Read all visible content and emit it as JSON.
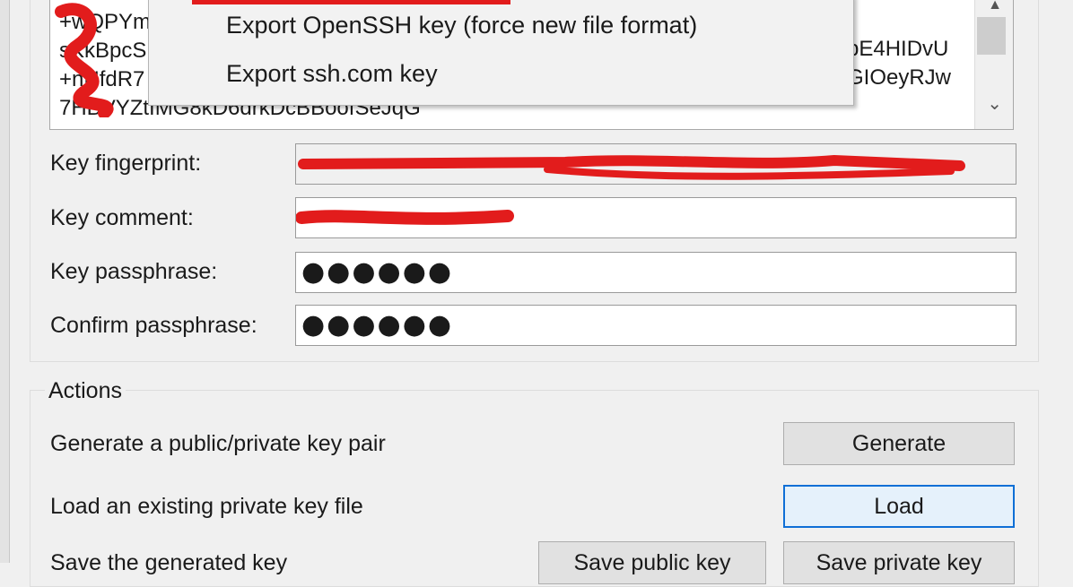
{
  "key_box": {
    "lines": [
      "+wQPYmbX",
      "sKkBpcS",
      "+nNfdR7",
      "7HBVYZtIMG8kD6drkDcBBoofSeJqG"
    ],
    "right_fragments": [
      "pE4HIDvU",
      "GIOeyRJw"
    ]
  },
  "context_menu": {
    "items": [
      "Export OpenSSH key (force new file format)",
      "Export ssh.com key"
    ]
  },
  "fields": {
    "fingerprint_label": "Key fingerprint:",
    "comment_label": "Key comment:",
    "passphrase_label": "Key passphrase:",
    "confirm_label": "Confirm passphrase:",
    "passphrase_value": "●●●●●●",
    "confirm_value": "●●●●●●"
  },
  "actions": {
    "title": "Actions",
    "generate_label": "Generate a public/private key pair",
    "generate_button": "Generate",
    "load_label": "Load an existing private key file",
    "load_button": "Load",
    "save_label": "Save the generated key",
    "save_public_button": "Save public key",
    "save_private_button": "Save private key"
  },
  "colors": {
    "redaction": "#e21c1c",
    "focus": "#0f6fd6"
  }
}
